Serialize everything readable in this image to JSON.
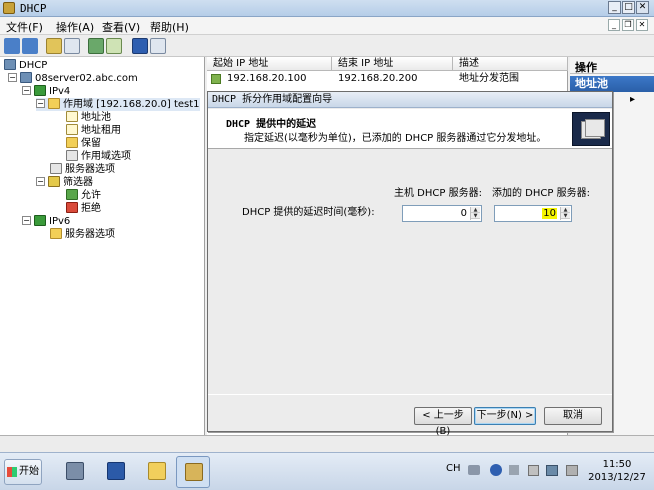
{
  "window": {
    "title": "DHCP"
  },
  "menu": {
    "file": "文件(F)",
    "action": "操作(A)",
    "view": "查看(V)",
    "help": "帮助(H)"
  },
  "tree": {
    "root": "DHCP",
    "server": "08server02.abc.com",
    "ipv4": "IPv4",
    "scope": "作用域 [192.168.20.0] test1",
    "address_pool": "地址池",
    "address_leases": "地址租用",
    "reservations": "保留",
    "scope_options": "作用域选项",
    "server_options_v4": "服务器选项",
    "filters": "筛选器",
    "allow": "允许",
    "deny": "拒绝",
    "ipv6": "IPv6",
    "server_options_v6": "服务器选项"
  },
  "list": {
    "columns": [
      "起始 IP 地址",
      "结束 IP 地址",
      "描述"
    ],
    "rows": [
      {
        "start": "192.168.20.100",
        "end": "192.168.20.200",
        "desc": "地址分发范围"
      }
    ]
  },
  "actions": {
    "header": "操作",
    "selected": "地址池",
    "more": "▸"
  },
  "wizard": {
    "title": "DHCP 拆分作用域配置向导",
    "heading": "DHCP 提供中的延迟",
    "description": "指定延迟(以毫秒为单位)，已添加的 DHCP 服务器通过它分发地址。",
    "host_label": "主机 DHCP 服务器:",
    "added_label": "添加的 DHCP 服务器:",
    "delay_label": "DHCP 提供的延迟时间(毫秒):",
    "host_value": "0",
    "added_value": "10",
    "back": "< 上一步(B)",
    "next": "下一步(N) >",
    "cancel": "取消"
  },
  "taskbar": {
    "start": "开始",
    "lang": "CH",
    "time": "11:50",
    "date": "2013/12/27"
  }
}
